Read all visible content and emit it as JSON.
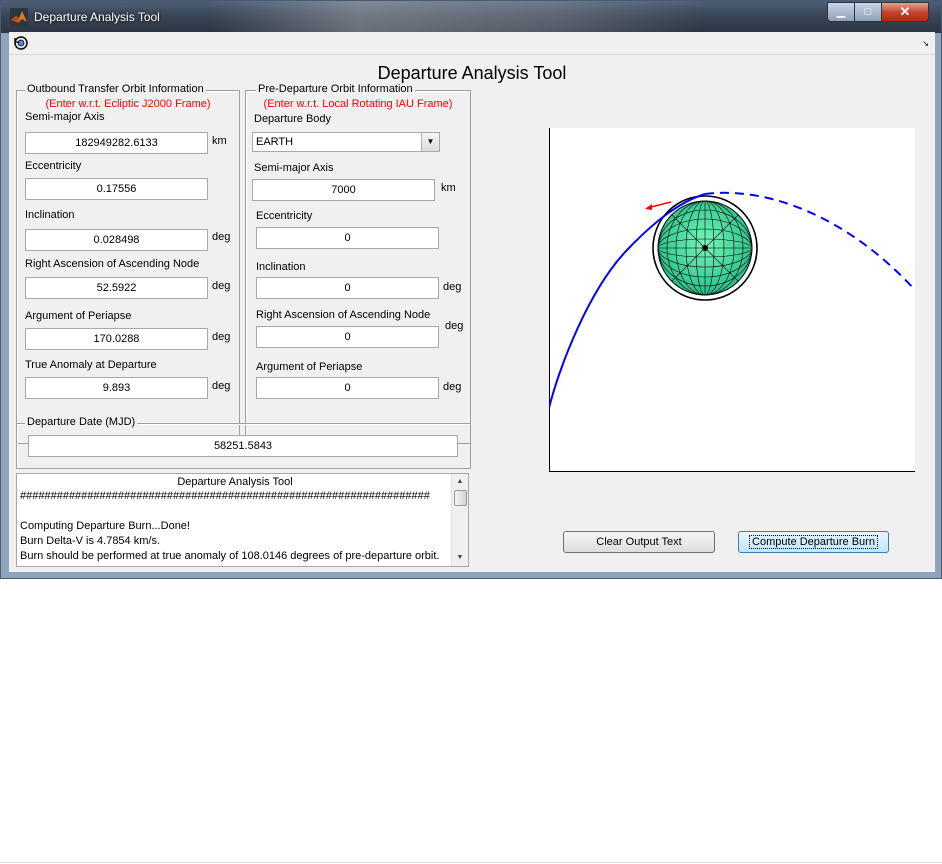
{
  "window": {
    "title": "Departure Analysis Tool",
    "min_glyph": "▁",
    "max_glyph": "□",
    "close_glyph": "✕",
    "toolbar_arrow": "↘"
  },
  "main_title": "Departure Analysis Tool",
  "outbound": {
    "title": "Outbound Transfer Orbit Information",
    "note": "(Enter w.r.t. Ecliptic J2000 Frame)",
    "sma_label": "Semi-major Axis",
    "sma_value": "182949282.6133",
    "sma_unit": "km",
    "ecc_label": "Eccentricity",
    "ecc_value": "0.17556",
    "inc_label": "Inclination",
    "inc_value": "0.028498",
    "inc_unit": "deg",
    "raan_label": "Right Ascension of Ascending Node",
    "raan_value": "52.5922",
    "raan_unit": "deg",
    "argp_label": "Argument of Periapse",
    "argp_value": "170.0288",
    "argp_unit": "deg",
    "ta_label": "True Anomaly at Departure",
    "ta_value": "9.893",
    "ta_unit": "deg"
  },
  "predeparture": {
    "title": "Pre-Departure Orbit Information",
    "note": "(Enter w.r.t. Local Rotating IAU Frame)",
    "body_label": "Departure Body",
    "body_value": "EARTH",
    "sma_label": "Semi-major Axis",
    "sma_value": "7000",
    "sma_unit": "km",
    "ecc_label": "Eccentricity",
    "ecc_value": "0",
    "inc_label": "Inclination",
    "inc_value": "0",
    "inc_unit": "deg",
    "raan_label": "Right Ascension of Ascending Node",
    "raan_value": "0",
    "raan_unit": "deg",
    "argp_label": "Argument of Periapse",
    "argp_value": "0",
    "argp_unit": "deg"
  },
  "departure_date": {
    "title": "Departure Date (MJD)",
    "value": "58251.5843"
  },
  "console": {
    "title": "Departure Analysis Tool",
    "lines": [
      "###################################################################",
      "",
      "Computing Departure Burn...Done!",
      "Burn Delta-V is 4.7854 km/s.",
      "Burn should be performed at true anomaly of 108.0146 degrees of pre-departure orbit."
    ]
  },
  "buttons": {
    "clear": "Clear Output Text",
    "compute": "Compute Departure Burn"
  },
  "colors": {
    "orbit": "#0000ff",
    "burn_vector": "#ff0000",
    "planet": "#3fe59a",
    "note_text": "#ff0000"
  }
}
